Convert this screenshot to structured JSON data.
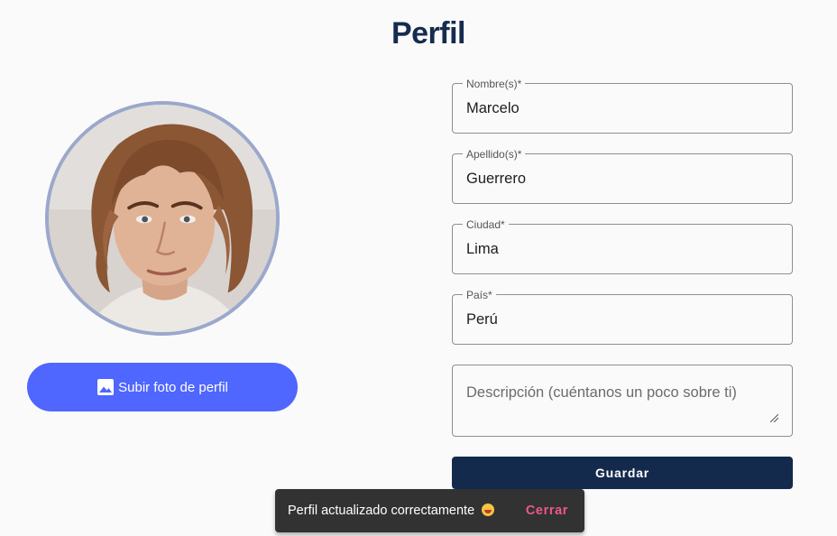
{
  "page": {
    "title": "Perfil"
  },
  "avatar": {
    "icon": "profile-photo"
  },
  "upload": {
    "label": "Subir foto de perfil",
    "icon": "image-icon",
    "color": "#4f66ff"
  },
  "form": {
    "nombre": {
      "label": "Nombre(s)*",
      "value": "Marcelo"
    },
    "apellido": {
      "label": "Apellido(s)*",
      "value": "Guerrero"
    },
    "ciudad": {
      "label": "Ciudad*",
      "value": "Lima"
    },
    "pais": {
      "label": "País*",
      "value": "Perú"
    },
    "descripcion": {
      "placeholder": "Descripción (cuéntanos un poco sobre ti)",
      "value": ""
    },
    "save_label": "Guardar"
  },
  "snackbar": {
    "message": "Perfil actualizado correctamente",
    "emoji_icon": "grinning-face-icon",
    "close_label": "Cerrar",
    "action_color": "#f0568c"
  },
  "colors": {
    "primary": "#142a4d",
    "title": "#152c4f"
  }
}
